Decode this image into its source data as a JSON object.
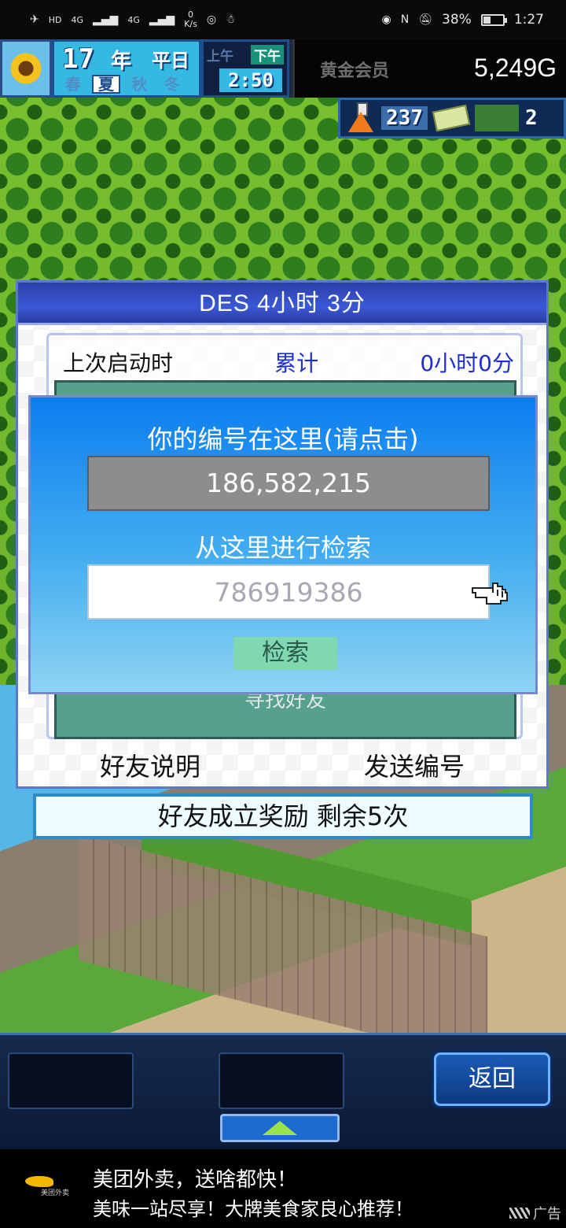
{
  "status_bar": {
    "hd": "HD",
    "net1": "4G",
    "net2": "4G",
    "speed_value": "0",
    "speed_unit": "K/s",
    "battery": "38%",
    "battery_level": 0.38,
    "time": "1:27"
  },
  "hud": {
    "year": "17",
    "year_label": "年",
    "weekday": "平日",
    "seasons": [
      "春",
      "夏",
      "秋",
      "冬"
    ],
    "active_season": "夏",
    "am": "上午",
    "pm": "下午",
    "clock": "2:50",
    "member": "黄金会员",
    "money": "5,249G"
  },
  "resources": {
    "research": "237",
    "tickets": "2"
  },
  "panel": {
    "title": "DES  4小时 3分",
    "last_launch_label": "上次启动时",
    "total_label": "累计",
    "total_value": "0小时0分",
    "find_friend": "寻找好友",
    "friend_help": "好友说明",
    "send_id": "发送编号",
    "reward": "好友成立奖励  剩余5次"
  },
  "dialog": {
    "title": "你的编号在这里(请点击)",
    "my_id": "186,582,215",
    "search_title": "从这里进行检索",
    "search_placeholder": "786919386",
    "search_button": "检索"
  },
  "controls": {
    "back": "返回"
  },
  "ad": {
    "logo_text": "美团外卖",
    "line1": "美团外卖，送啥都快！",
    "line2": "美味一站尽享！大牌美食家良心推荐！",
    "tag": "广告"
  },
  "colors": {
    "dialog_top": "#0c7ef0",
    "panel_title": "#2c3ea8",
    "reward_border": "#2f8bc4",
    "search_button": "#7fd8b0"
  }
}
